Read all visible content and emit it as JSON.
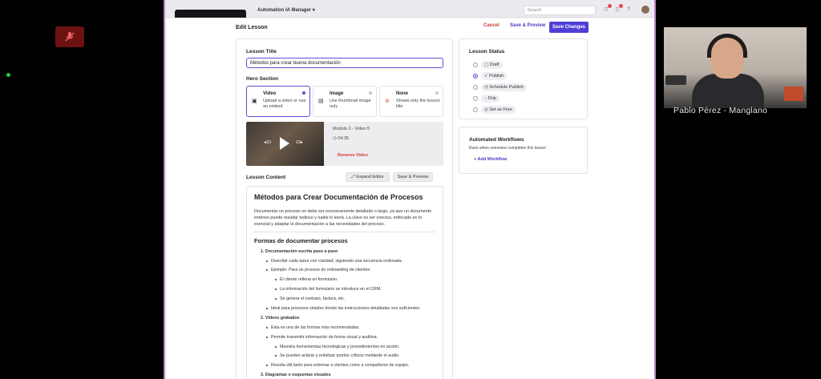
{
  "app": {
    "name": "Automation IA Manager ▾"
  },
  "topbar": {
    "search_placeholder": "Search"
  },
  "page": {
    "title": "Edit Lesson",
    "cancel": "Cancel",
    "save_preview": "Save & Preview",
    "save_changes": "Save Changes"
  },
  "lesson_title": {
    "label": "Lesson Title",
    "value": "Métodos para crear buena documentación"
  },
  "hero": {
    "label": "Hero Section",
    "options": [
      {
        "title": "Video",
        "desc": "Upload a video or use an embed"
      },
      {
        "title": "Image",
        "desc": "Use thumbnail image only"
      },
      {
        "title": "None",
        "desc": "Shows only the lesson title"
      }
    ]
  },
  "video": {
    "title": "Modulo 2 - Video 5",
    "duration": "04:35",
    "remove": "Remove Video",
    "skip_back": "◂10",
    "skip_fwd": "10▸"
  },
  "content": {
    "label": "Lesson Content",
    "expand": "Expand Editor",
    "save_preview": "Save & Preview",
    "h1": "Métodos para Crear Documentación de Procesos",
    "intro": "Documentar un proceso no debe ser excesivamente detallado o largo, ya que un documento extenso puede resultar tedioso y nadie lo leerá. La clave es ser conciso, enfocado en lo esencial y adaptar la documentación a las necesidades del proceso.",
    "h2": "Formas de documentar procesos",
    "items": [
      "1.  Documentación escrita paso a paso",
      "Describir cada tarea con claridad, siguiendo una secuencia ordenada.",
      "Ejemplo: Para un proceso de onboarding de clientes:",
      "El cliente rellena un formulario.",
      "La información del formulario se introduce en el CRM.",
      "Se genera el contrato, factura, etc.",
      "Ideal para procesos simples donde las instrucciones detalladas son suficientes.",
      "2.  Vídeos grabados",
      "Esta es una de las formas más recomendadas.",
      "Permite transmitir información de forma visual y auditiva.",
      "Muestra herramientas tecnológicas y procedimientos en acción.",
      "Se pueden aclarar y enfatizar puntos críticos mediante el audio.",
      "Resulta útil tanto para entrenar a clientes como a compañeros de equipo.",
      "3.  Diagramas o esquemas visuales"
    ]
  },
  "status": {
    "label": "Lesson Status",
    "options": [
      "Draft",
      "Publish",
      "Schedule Publish",
      "Drip",
      "Set as Free"
    ],
    "selected": "Publish"
  },
  "workflows": {
    "label": "Automated Workflows",
    "desc": "Runs when someone completes this lesson",
    "add": "Add Workflow"
  },
  "participant": {
    "name": "Pablo Pérez - Manglano"
  },
  "colors": {
    "accent": "#4f3fd6",
    "danger": "#d43a3a",
    "frame": "#b886c9"
  }
}
